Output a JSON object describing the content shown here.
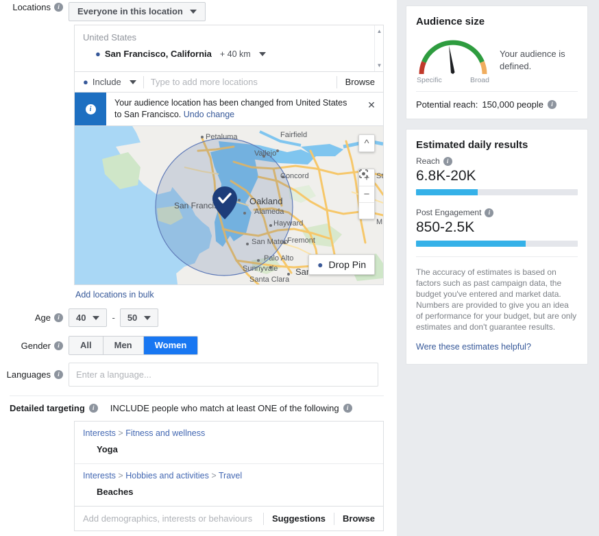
{
  "locations": {
    "label": "Locations",
    "info_icon": "info-icon",
    "everyone_button": "Everyone in this location",
    "country": "United States",
    "selected_location": "San Francisco, California",
    "radius": "+ 40 km",
    "include_label": "Include",
    "add_locations_placeholder": "Type to add more locations",
    "browse_label": "Browse",
    "add_in_bulk": "Add locations in bulk",
    "banner": {
      "text": "Your audience location has been changed from United States to San Francisco.",
      "undo_link": "Undo change",
      "close_icon": "close-icon"
    },
    "map": {
      "drop_pin_label": "Drop Pin",
      "zoom_in": "+",
      "zoom_out": "−",
      "city_labels": [
        "Petaluma",
        "Fairfield",
        "Vallejo",
        "Concord",
        "Sto",
        "San Francisco",
        "Oakland",
        "Alameda",
        "Hayward",
        "San Mateo",
        "Fremont",
        "Palo Alto",
        "Sunnyvale",
        "Santa Clara",
        "San",
        "M"
      ]
    }
  },
  "age": {
    "label": "Age",
    "min": "40",
    "max": "50",
    "separator": "-"
  },
  "gender": {
    "label": "Gender",
    "options": [
      "All",
      "Men",
      "Women"
    ],
    "selected": "Women"
  },
  "languages": {
    "label": "Languages",
    "placeholder": "Enter a language...",
    "value": ""
  },
  "detailed_targeting": {
    "label": "Detailed targeting",
    "include_text": "INCLUDE people who match at least ONE of the following",
    "groups": [
      {
        "path": [
          "Interests",
          "Fitness and wellness"
        ],
        "item": "Yoga"
      },
      {
        "path": [
          "Interests",
          "Hobbies and activities",
          "Travel"
        ],
        "item": "Beaches"
      }
    ],
    "placeholder": "Add demographics, interests or behaviours",
    "suggestions_label": "Suggestions",
    "browse_label": "Browse"
  },
  "audience_size": {
    "title": "Audience size",
    "gauge": {
      "left_label": "Specific",
      "right_label": "Broad",
      "needle_angle_deg": -8,
      "colors": {
        "specific": "#c0392b",
        "middle": "#2e9c3f",
        "broad": "#f0ad5e"
      }
    },
    "message": "Your audience is defined.",
    "potential_reach_label": "Potential reach:",
    "potential_reach_value": "150,000 people"
  },
  "estimated_results": {
    "title": "Estimated daily results",
    "metrics": [
      {
        "label": "Reach",
        "value": "6.8K-20K",
        "fill_percent": 38
      },
      {
        "label": "Post Engagement",
        "value": "850-2.5K",
        "fill_percent": 68
      }
    ],
    "disclaimer": "The accuracy of estimates is based on factors such as past campaign data, the budget you've entered and market data. Numbers are provided to give you an idea of performance for your budget, but are only estimates and don't guarantee results.",
    "helpful_link": "Were these estimates helpful?"
  },
  "colors": {
    "accent_blue": "#1877f2",
    "link_blue": "#365899",
    "bar_blue": "#35b1e8",
    "banner_blue": "#1d6fc1"
  }
}
